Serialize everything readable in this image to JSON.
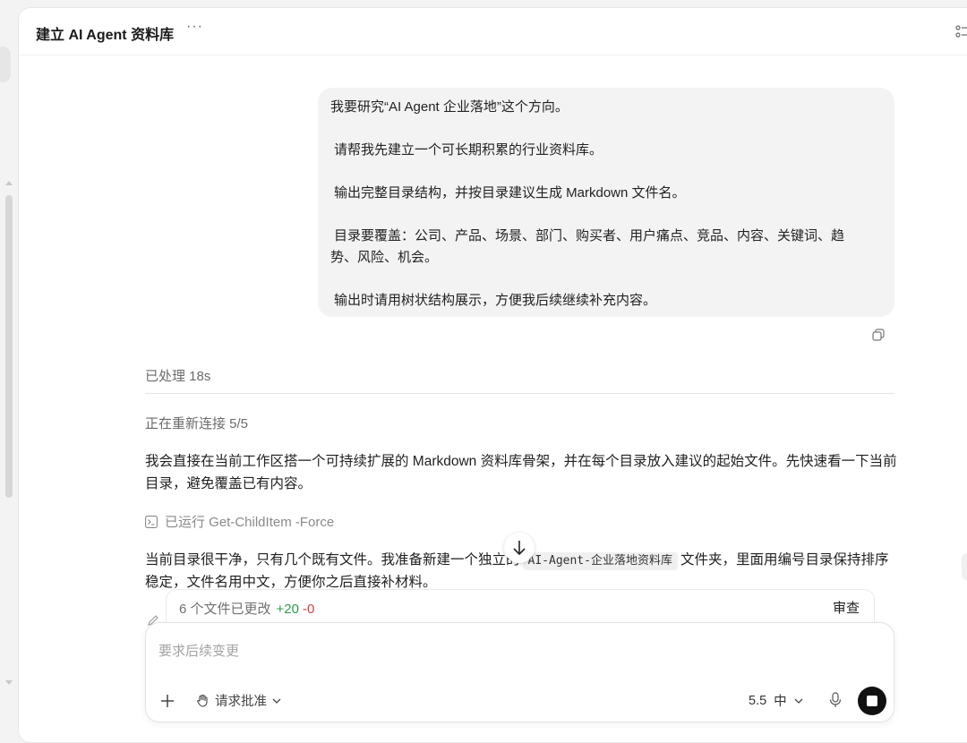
{
  "header": {
    "title": "建立 AI Agent 资料库",
    "more_label": "···"
  },
  "user_message": {
    "line1": "我要研究“AI Agent 企业落地”这个方向。",
    "line2": "请帮我先建立一个可长期积累的行业资料库。",
    "line3": "输出完整目录结构，并按目录建议生成 Markdown 文件名。",
    "line4a": "目录要覆盖：公司、产品、场景、部门、购买者、用户痛点、竞品、内容、关键词、趋",
    "line4b": "势、风险、机会。",
    "line5": "输出时请用树状结构展示，方便我后续继续补充内容。"
  },
  "assistant": {
    "processed": "已处理 18s",
    "reconnect": "正在重新连接 5/5",
    "para1": "我会直接在当前工作区搭一个可持续扩展的 Markdown 资料库骨架，并在每个目录放入建议的起始文件。先快速看一下当前目录，避免覆盖已有内容。",
    "command": "已运行 Get-ChildItem -Force",
    "para2_before": "当前目录很干净，只有几个既有文件。我准备新建一个独立的",
    "para2_code": "AI-Agent-企业落地资料库",
    "para2_after": "文件夹，里面用编号目录保持排序稳定，文件名用中文，方便你之后直接补材料。"
  },
  "changes": {
    "summary": "6 个文件已更改",
    "additions": "+20",
    "deletions": "-0",
    "review_label": "审查"
  },
  "composer": {
    "placeholder": "要求后续变更",
    "approval_label": "请求批准",
    "model_version": "5.5",
    "model_level": "中"
  },
  "icons": [
    "more-icon",
    "tree-view-icon",
    "copy-icon",
    "terminal-icon",
    "scroll-down-icon",
    "pencil-icon",
    "plus-icon",
    "hand-icon",
    "chevron-down-icon",
    "mic-icon",
    "stop-icon"
  ],
  "colors": {
    "additions": "#2a9d4a",
    "deletions": "#d23f3f",
    "stop_button": "#111111",
    "bubble": "#f3f3f3"
  }
}
